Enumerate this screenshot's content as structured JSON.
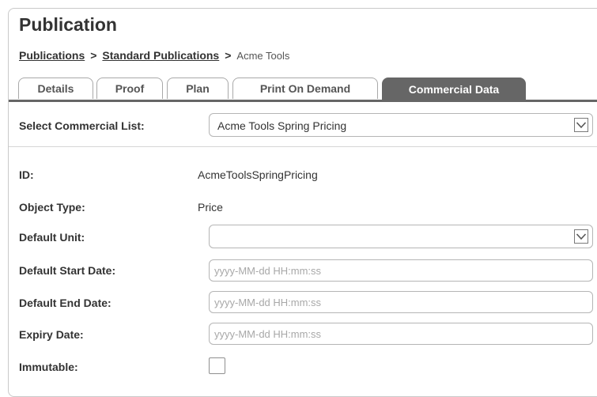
{
  "page": {
    "title": "Publication"
  },
  "breadcrumb": {
    "items": [
      "Publications",
      "Standard Publications"
    ],
    "separator": ">",
    "current": "Acme Tools"
  },
  "tabs": [
    {
      "label": "Details",
      "active": false
    },
    {
      "label": "Proof",
      "active": false
    },
    {
      "label": "Plan",
      "active": false
    },
    {
      "label": "Print On Demand",
      "active": false
    },
    {
      "label": "Commercial Data",
      "active": true
    }
  ],
  "form": {
    "commercial_list": {
      "label": "Select Commercial List:",
      "value": "Acme Tools Spring Pricing",
      "icon": "chevron-down-icon"
    },
    "id": {
      "label": "ID:",
      "value": "AcmeToolsSpringPricing"
    },
    "object_type": {
      "label": "Object Type:",
      "value": "Price"
    },
    "default_unit": {
      "label": "Default Unit:",
      "value": "",
      "icon": "chevron-down-icon"
    },
    "default_start_date": {
      "label": "Default Start Date:",
      "value": "",
      "placeholder": "yyyy-MM-dd HH:mm:ss"
    },
    "default_end_date": {
      "label": "Default End Date:",
      "value": "",
      "placeholder": "yyyy-MM-dd HH:mm:ss"
    },
    "expiry_date": {
      "label": "Expiry Date:",
      "value": "",
      "placeholder": "yyyy-MM-dd HH:mm:ss"
    },
    "immutable": {
      "label": "Immutable:",
      "checked": false
    }
  },
  "colors": {
    "active_tab": "#666666",
    "border": "#b5b5b5",
    "text": "#333333",
    "placeholder": "#a8a8a8"
  }
}
